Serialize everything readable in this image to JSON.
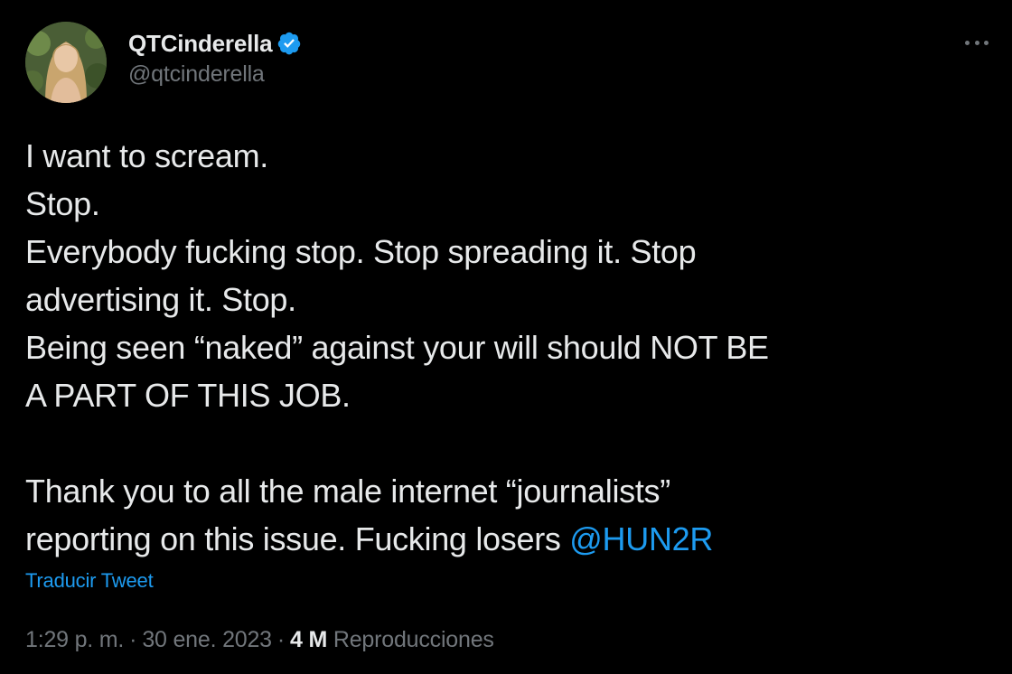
{
  "author": {
    "display_name": "QTCinderella",
    "handle": "@qtcinderella",
    "verified": true
  },
  "tweet": {
    "lines": [
      "I want to scream.",
      "Stop.",
      "Everybody fucking stop. Stop spreading it. Stop",
      "advertising it. Stop.",
      "Being seen “naked” against your will should NOT BE",
      "A PART OF THIS JOB.",
      "",
      "Thank you to all the male internet “journalists”",
      "reporting on this issue. Fucking losers "
    ],
    "mention": "@HUN2R",
    "translate_label": "Traducir Tweet"
  },
  "meta": {
    "time": "1:29 p. m.",
    "separator": "·",
    "date": "30 ene. 2023",
    "views_count": "4 M",
    "views_label": "Reproducciones"
  },
  "icons": {
    "verified": "verified-badge-icon",
    "more": "more-options-icon"
  },
  "colors": {
    "background": "#000000",
    "text": "#e7e9ea",
    "secondary": "#71767b",
    "accent": "#1d9bf0"
  }
}
